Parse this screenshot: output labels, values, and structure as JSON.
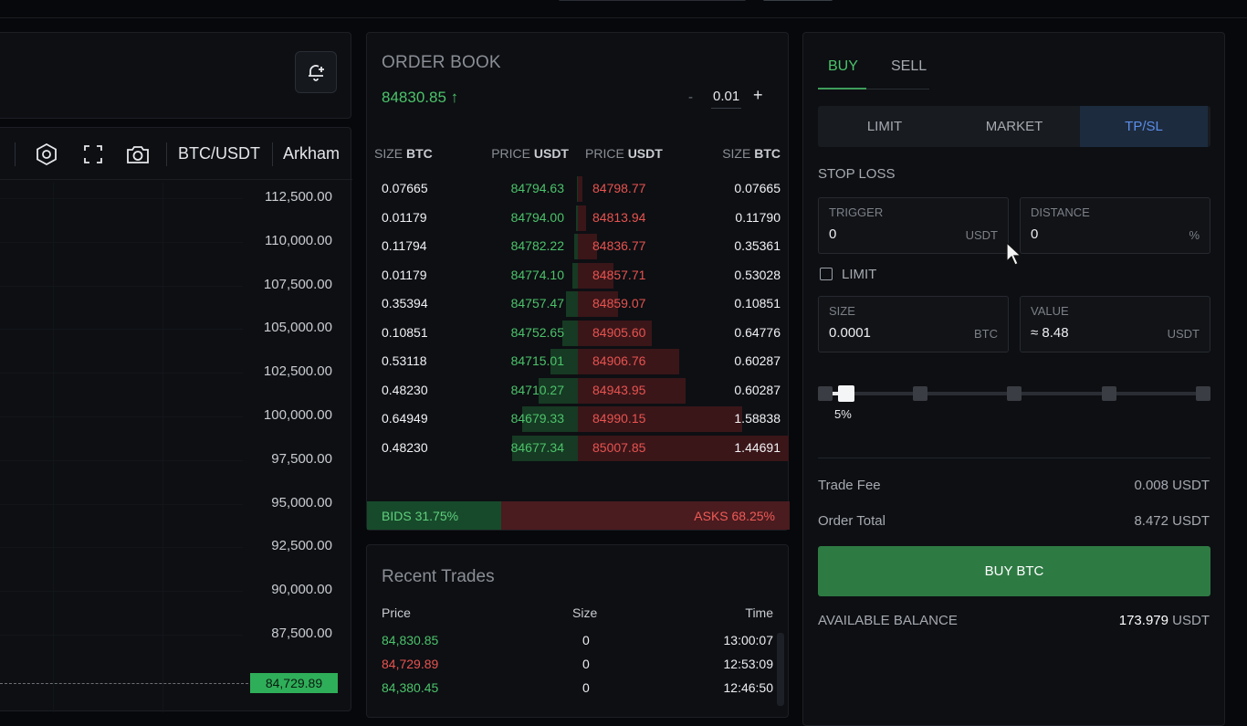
{
  "chart": {
    "toolbar": {
      "pair": "BTC/USDT",
      "source": "Arkham"
    },
    "price_axis": [
      "112,500.00",
      "110,000.00",
      "107,500.00",
      "105,000.00",
      "102,500.00",
      "100,000.00",
      "97,500.00",
      "95,000.00",
      "92,500.00",
      "90,000.00",
      "87,500.00"
    ],
    "current_price_tag": "84,729.89"
  },
  "order_book": {
    "title": "ORDER BOOK",
    "last_price": "84830.85 ↑",
    "step_minus": "-",
    "step_value": "0.01",
    "step_plus": "+",
    "headers": {
      "bid_size": "SIZE",
      "bid_size_unit": "BTC",
      "bid_price": "PRICE",
      "bid_price_unit": "USDT",
      "ask_price": "PRICE",
      "ask_price_unit": "USDT",
      "ask_size": "SIZE",
      "ask_size_unit": "BTC"
    },
    "rows": [
      {
        "bid_size": "0.07665",
        "bid_price": "84794.63",
        "ask_price": "84798.77",
        "ask_size": "0.07665",
        "bid_depth": 0.01,
        "ask_depth": 0.02
      },
      {
        "bid_size": "0.01179",
        "bid_price": "84794.00",
        "ask_price": "84813.94",
        "ask_size": "0.11790",
        "bid_depth": 0.02,
        "ask_depth": 0.04
      },
      {
        "bid_size": "0.11794",
        "bid_price": "84782.22",
        "ask_price": "84836.77",
        "ask_size": "0.35361",
        "bid_depth": 0.04,
        "ask_depth": 0.09
      },
      {
        "bid_size": "0.01179",
        "bid_price": "84774.10",
        "ask_price": "84857.71",
        "ask_size": "0.53028",
        "bid_depth": 0.05,
        "ask_depth": 0.17
      },
      {
        "bid_size": "0.35394",
        "bid_price": "84757.47",
        "ask_price": "84859.07",
        "ask_size": "0.10851",
        "bid_depth": 0.12,
        "ask_depth": 0.19
      },
      {
        "bid_size": "0.10851",
        "bid_price": "84752.65",
        "ask_price": "84905.60",
        "ask_size": "0.64776",
        "bid_depth": 0.15,
        "ask_depth": 0.35
      },
      {
        "bid_size": "0.53118",
        "bid_price": "84715.01",
        "ask_price": "84906.76",
        "ask_size": "0.60287",
        "bid_depth": 0.27,
        "ask_depth": 0.48
      },
      {
        "bid_size": "0.48230",
        "bid_price": "84710.27",
        "ask_price": "84943.95",
        "ask_size": "0.60287",
        "bid_depth": 0.39,
        "ask_depth": 0.51
      },
      {
        "bid_size": "0.64949",
        "bid_price": "84679.33",
        "ask_price": "84990.15",
        "ask_size": "1.58838",
        "bid_depth": 0.55,
        "ask_depth": 0.78
      },
      {
        "bid_size": "0.48230",
        "bid_price": "84677.34",
        "ask_price": "85007.85",
        "ask_size": "1.44691",
        "bid_depth": 0.65,
        "ask_depth": 1.0
      }
    ],
    "bids_label": "BIDS 31.75%",
    "asks_label": "ASKS 68.25%",
    "bids_fraction": 0.3175
  },
  "recent_trades": {
    "title": "Recent Trades",
    "headers": {
      "price": "Price",
      "size": "Size",
      "time": "Time"
    },
    "rows": [
      {
        "price": "84,830.85",
        "size": "0",
        "time": "13:00:07",
        "side": "buy"
      },
      {
        "price": "84,729.89",
        "size": "0",
        "time": "12:53:09",
        "side": "sell"
      },
      {
        "price": "84,380.45",
        "size": "0",
        "time": "12:46:50",
        "side": "buy"
      }
    ]
  },
  "order_form": {
    "tabs": {
      "buy": "BUY",
      "sell": "SELL"
    },
    "types": {
      "limit": "LIMIT",
      "market": "MARKET",
      "tpsl": "TP/SL"
    },
    "stop_loss_label": "STOP LOSS",
    "trigger": {
      "label": "TRIGGER",
      "value": "0",
      "unit": "USDT"
    },
    "distance": {
      "label": "DISTANCE",
      "value": "0",
      "unit": "%"
    },
    "limit_checkbox": "LIMIT",
    "size": {
      "label": "SIZE",
      "value": "0.0001",
      "unit": "BTC"
    },
    "value": {
      "label": "VALUE",
      "value": "≈ 8.48",
      "unit": "USDT"
    },
    "slider_percent": 5,
    "slider_label": "5%",
    "trade_fee_label": "Trade Fee",
    "trade_fee_value": "0.008 USDT",
    "order_total_label": "Order Total",
    "order_total_value": "8.472 USDT",
    "submit_label": "BUY BTC",
    "balance_label": "AVAILABLE BALANCE",
    "balance_value": "173.979",
    "balance_unit": "USDT"
  },
  "colors": {
    "bid": "#4cc36a",
    "ask": "#e8534f",
    "accent": "#5b8de8",
    "buy_button": "#2e7a43"
  }
}
